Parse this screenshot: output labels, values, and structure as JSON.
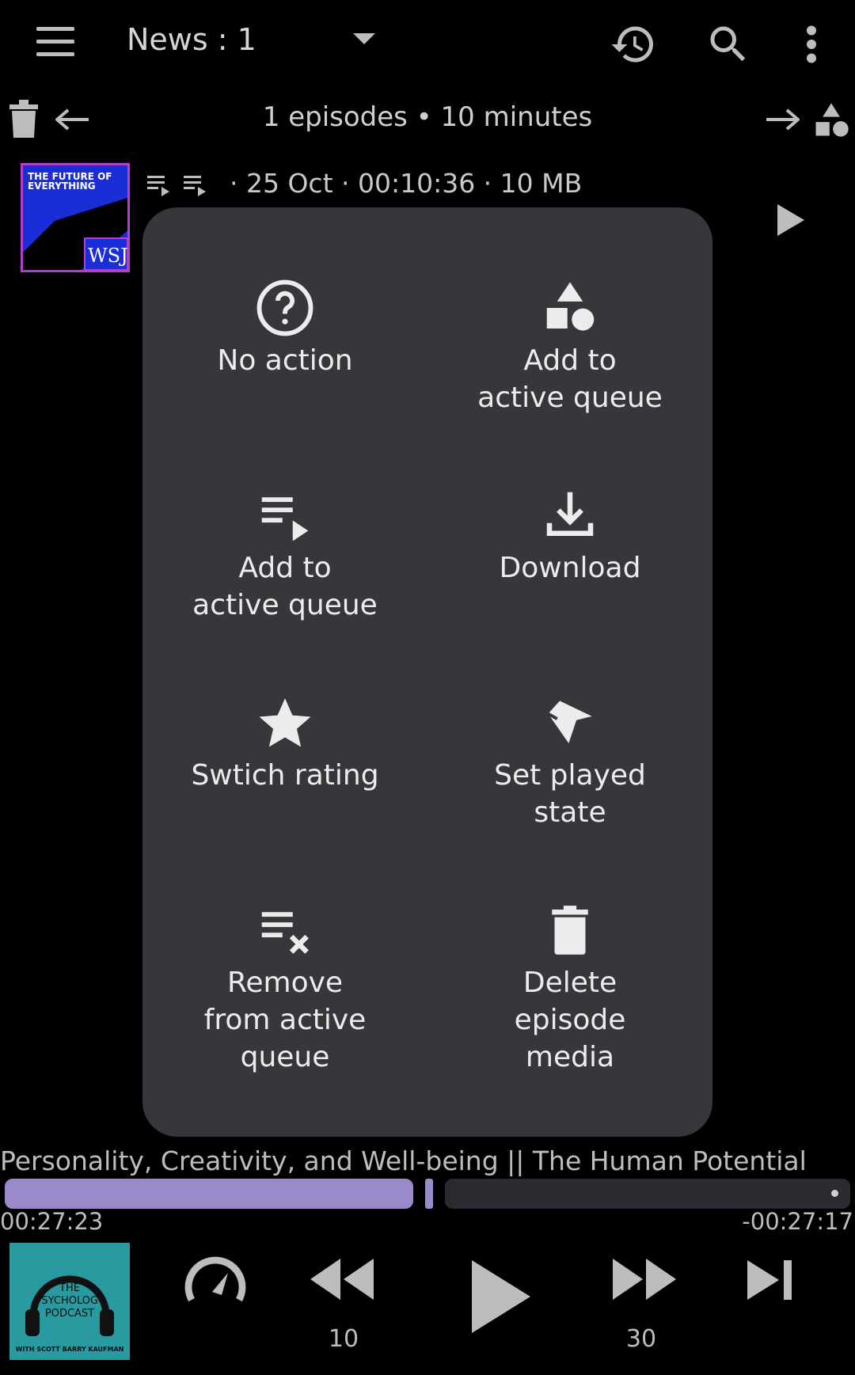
{
  "toolbar": {
    "title": "News : 1",
    "icons": [
      "menu-icon",
      "dropdown-icon",
      "history-icon",
      "search-icon",
      "more-vert-icon"
    ]
  },
  "filter_bar": {
    "summary": "1 episodes  •  10 minutes",
    "icons": [
      "delete-icon",
      "arrow-left-icon",
      "arrow-right-icon",
      "category-icon"
    ]
  },
  "episode": {
    "cover_text": "THE FUTURE OF EVERYTHING",
    "cover_brand": "WSJ",
    "meta": "·  25 Oct  ·  00:10:36  ·  10 MB"
  },
  "swipe_actions": {
    "options": [
      {
        "label": "No action",
        "icon": "help-circle-icon"
      },
      {
        "label": "Add to\nactive queue",
        "icon": "category-icon"
      },
      {
        "label": "Add to\nactive queue",
        "icon": "playlist-play-icon"
      },
      {
        "label": "Download",
        "icon": "download-icon"
      },
      {
        "label": "Swtich rating",
        "icon": "star-icon"
      },
      {
        "label": "Set played\nstate",
        "icon": "played-state-icon"
      },
      {
        "label": "Remove\nfrom active\nqueue",
        "icon": "playlist-remove-icon"
      },
      {
        "label": "Delete\nepisode\nmedia",
        "icon": "delete-icon"
      }
    ]
  },
  "player": {
    "title": "Personality, Creativity, and Well-being || The Human Potential",
    "elapsed": "00:27:23",
    "remaining": "-00:27:17",
    "progress_fraction": 0.5,
    "cover_text": "THE PSYCHOLOGY PODCAST",
    "cover_sub": "WITH SCOTT BARRY KAUFMAN",
    "rewind_seconds": "10",
    "forward_seconds": "30"
  }
}
